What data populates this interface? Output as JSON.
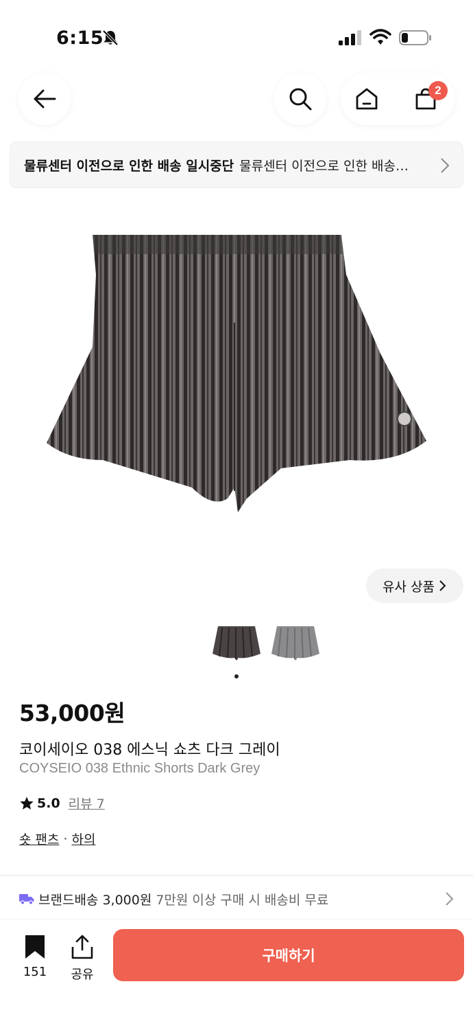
{
  "status_bar": {
    "time": "6:15"
  },
  "header": {
    "cart_count": "2"
  },
  "notice": {
    "title": "물류센터 이전으로 인한 배송 일시중단",
    "text": "물류센터 이전으로 인한 배송 일시중단"
  },
  "similar_button": {
    "label": "유사 상품"
  },
  "product": {
    "price": "53,000원",
    "name_ko": "코이세이오 038 에스닉 쇼츠 다크 그레이",
    "name_en": "COYSEIO 038 Ethnic Shorts Dark Grey",
    "rating": "5.0",
    "review_label": "리뷰 7",
    "category_1": "숏 팬츠",
    "category_separator": "·",
    "category_2": "하의"
  },
  "shipping": {
    "title": "브랜드배송 3,000원",
    "note": "7만원 이상 구매 시 배송비 무료"
  },
  "bottom_bar": {
    "bookmark_count": "151",
    "share_label": "공유",
    "buy_label": "구매하기"
  },
  "colors": {
    "accent": "#ef6150",
    "badge": "#ef5a4f",
    "truck": "#7b6cf6"
  },
  "icons": [
    "back-arrow-icon",
    "search-icon",
    "home-icon",
    "cart-icon",
    "bookmark-icon",
    "share-icon",
    "truck-icon",
    "star-icon",
    "chevron-right-icon"
  ]
}
